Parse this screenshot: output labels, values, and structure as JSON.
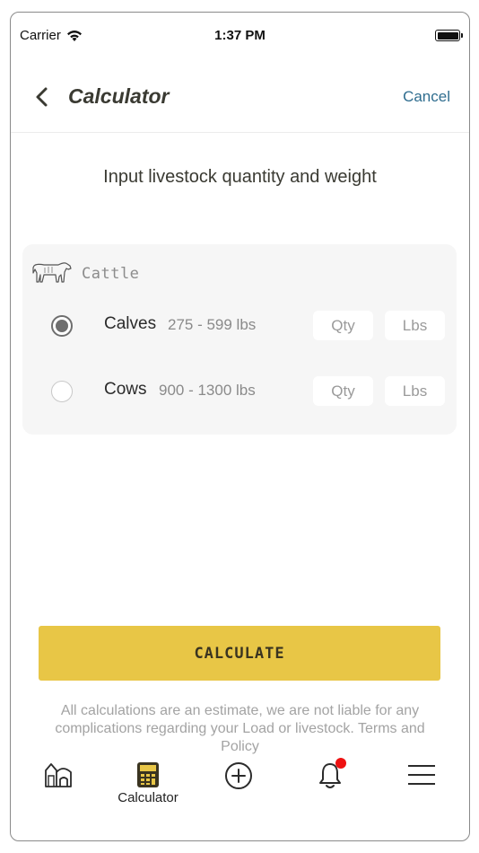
{
  "status_bar": {
    "carrier": "Carrier",
    "time": "1:37 PM"
  },
  "nav": {
    "title": "Calculator",
    "cancel": "Cancel"
  },
  "subtitle": "Input livestock quantity and weight",
  "category": {
    "label": "Cattle",
    "icon": "cow-icon"
  },
  "rows": [
    {
      "animal": "Calves",
      "range": "275 - 599 lbs",
      "selected": true,
      "qty_placeholder": "Qty",
      "lbs_placeholder": "Lbs"
    },
    {
      "animal": "Cows",
      "range": "900 - 1300 lbs",
      "selected": false,
      "qty_placeholder": "Qty",
      "lbs_placeholder": "Lbs"
    }
  ],
  "calculate_label": "CALCULATE",
  "disclaimer": "All calculations are an estimate, we are not liable for any complications regarding your Load or livestock. Terms and Policy",
  "tabs": [
    {
      "icon": "barn-icon",
      "label": ""
    },
    {
      "icon": "calculator-icon",
      "label": "Calculator"
    },
    {
      "icon": "plus-circle-icon",
      "label": ""
    },
    {
      "icon": "bell-icon",
      "label": "",
      "badge": true
    },
    {
      "icon": "menu-icon",
      "label": ""
    }
  ],
  "colors": {
    "accent": "#e8c646",
    "link": "#2f6d8f",
    "badge": "#ee1111"
  }
}
